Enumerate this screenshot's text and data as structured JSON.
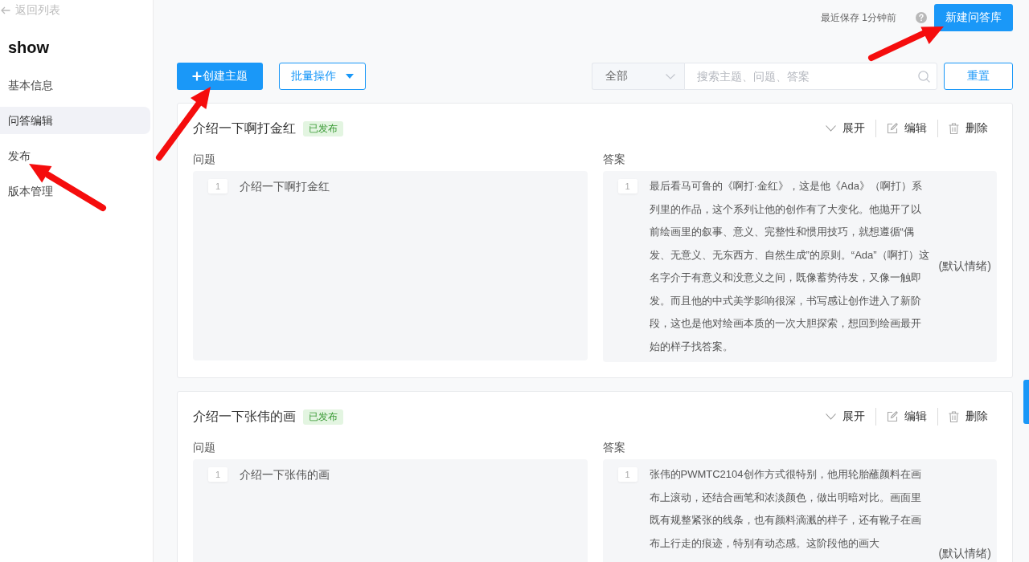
{
  "sidebar": {
    "back_link": "返回列表",
    "title": "show",
    "items": [
      {
        "label": "基本信息",
        "selected": false
      },
      {
        "label": "问答编辑",
        "selected": true
      },
      {
        "label": "发布",
        "selected": false
      },
      {
        "label": "版本管理",
        "selected": false
      }
    ]
  },
  "header": {
    "save_status": "最近保存 1分钟前",
    "primary_button": "新建问答库"
  },
  "toolbar": {
    "create_button": "创建主题",
    "batch_button": "批量操作",
    "filter": {
      "value": "全部"
    },
    "search": {
      "placeholder": "搜索主题、问题、答案"
    },
    "reset_button": "重置"
  },
  "topics": [
    {
      "title": "介绍一下啊打金红",
      "status": {
        "label": "已发布",
        "kind": "published"
      },
      "actions": [
        {
          "kind": "expand",
          "label": "展开"
        },
        {
          "kind": "edit",
          "label": "编辑"
        },
        {
          "kind": "delete",
          "label": "删除"
        }
      ],
      "question_label": "问题",
      "answer_label": "答案",
      "questions": [
        {
          "index": "1",
          "text": "介绍一下啊打金红"
        }
      ],
      "answers": [
        {
          "index": "1",
          "text": "最后看马可鲁的《啊打·金红》，这是他《Ada》（啊打）系列里的作品，这个系列让他的创作有了大变化。他抛开了以前绘画里的叙事、意义、完整性和惯用技巧，就想遵循“偶发、无意义、无东西方、自然生成”的原则。“Ada”（啊打）这名字介于有意义和没意义之间，既像蓄势待发，又像一触即发。而且他的中式美学影响很深，书写感让创作进入了新阶段，这也是他对绘画本质的一次大胆探索，想回到绘画最开始的样子找答案。",
          "emotion": "(默认情绪)"
        }
      ]
    },
    {
      "title": "介绍一下张伟的画",
      "status": {
        "label": "已发布",
        "kind": "published"
      },
      "actions": [
        {
          "kind": "expand",
          "label": "展开"
        },
        {
          "kind": "edit",
          "label": "编辑"
        },
        {
          "kind": "delete",
          "label": "删除"
        }
      ],
      "question_label": "问题",
      "answer_label": "答案",
      "questions": [
        {
          "index": "1",
          "text": "介绍一下张伟的画"
        }
      ],
      "answers": [
        {
          "index": "1",
          "text": "张伟的PWMTC2104创作方式很特别，他用轮胎蘸颜料在画布上滚动，还结合画笔和浓淡颜色，做出明暗对比。画面里既有规整紧张的线条，也有颜料滴溅的样子，还有靴子在画布上行走的痕迹，特别有动态感。这阶段他的画大",
          "emotion": "(默认情绪)"
        }
      ]
    }
  ]
}
